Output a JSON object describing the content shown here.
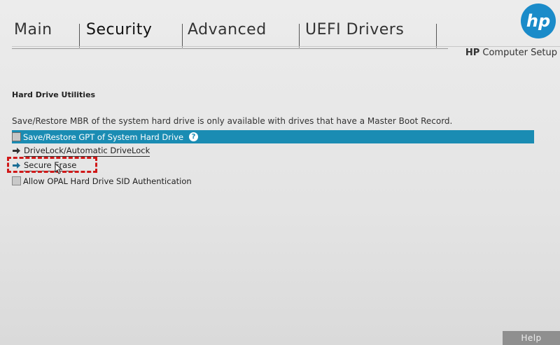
{
  "tabs": [
    {
      "label": "Main",
      "active": false
    },
    {
      "label": "Security",
      "active": true
    },
    {
      "label": "Advanced",
      "active": false
    },
    {
      "label": "UEFI Drivers",
      "active": false
    }
  ],
  "logo": {
    "text": "hp",
    "color": "#1a8bc9"
  },
  "header": {
    "app_brand": "HP",
    "app_suffix": " Computer Setup"
  },
  "section": {
    "title": "Hard Drive Utilities"
  },
  "info_text": "Save/Restore MBR of the system hard drive is only available with drives that have a Master Boot Record.",
  "items": [
    {
      "label": "Save/Restore GPT of System Hard Drive",
      "type": "checkbox",
      "highlighted": true,
      "help_icon": "?"
    },
    {
      "label": "DriveLock/Automatic DriveLock",
      "type": "submenu",
      "icon": "arrow-right-icon"
    },
    {
      "label": "Secure Erase",
      "type": "submenu",
      "icon": "arrow-right-icon",
      "annotated": true
    },
    {
      "label": "Allow OPAL Hard Drive SID Authentication",
      "type": "checkbox",
      "highlighted": false
    }
  ],
  "footer": {
    "help_label": "Help"
  },
  "colors": {
    "highlight": "#1a8cb3",
    "annotation": "#d01919",
    "brand": "#1a8bc9"
  }
}
